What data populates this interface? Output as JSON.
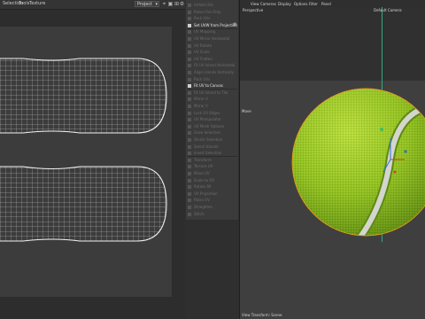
{
  "uv_editor": {
    "menu": [
      "Selection",
      "Tools",
      "Texture"
    ],
    "dropdown_value": "Project",
    "toolbar_icons": [
      "pin-icon",
      "lock-icon",
      "grid-icon",
      "settings-icon"
    ]
  },
  "command_panel": {
    "items": [
      {
        "label": "Unfold UVs",
        "active": false
      },
      {
        "label": "Relax UVs Only",
        "active": false
      },
      {
        "label": "Pack UVs",
        "active": false
      },
      {
        "label": "Set UVW from Projection",
        "active": true
      },
      {
        "label": "UV Mapping",
        "active": false
      },
      {
        "label": "UV Mirror Horizontal",
        "active": false
      },
      {
        "label": "UV Rotate",
        "active": false
      },
      {
        "label": "UV Scale",
        "active": false
      },
      {
        "label": "UV Flatten",
        "active": false
      },
      {
        "label": "Fit UV Island Horizontal",
        "active": false
      },
      {
        "label": "Align Islands Vertically",
        "active": false
      },
      {
        "label": "Pack UVs",
        "active": false
      },
      {
        "label": "Fit UV to Canvas",
        "active": true
      },
      {
        "label": "Fit UV Island to Tile",
        "active": false
      },
      {
        "label": "Mirror U",
        "active": false
      },
      {
        "label": "Mirror V",
        "active": false
      },
      {
        "label": "Lock UV Edges",
        "active": false
      },
      {
        "label": "UV Manipulator",
        "active": false
      },
      {
        "label": "UV Mesh Options",
        "active": false
      },
      {
        "label": "Grow Selection",
        "active": false
      },
      {
        "label": "Shrink Selection",
        "active": false
      },
      {
        "label": "Select Islands",
        "active": false
      },
      {
        "label": "Invert Selection",
        "active": false
      },
      {
        "label": "Transform",
        "active": false
      },
      {
        "label": "Terrace UV",
        "active": false
      },
      {
        "label": "Move UV",
        "active": false
      },
      {
        "label": "Scale to Fill",
        "active": false
      },
      {
        "label": "Rotate 90",
        "active": false
      },
      {
        "label": "UV Projection",
        "active": false
      },
      {
        "label": "Relax UV",
        "active": false
      },
      {
        "label": "Straighten",
        "active": false
      },
      {
        "label": "Stitch",
        "active": false
      }
    ]
  },
  "viewport": {
    "menu": [
      "View",
      "Cameras",
      "Display",
      "Options",
      "Filter",
      "Panel"
    ],
    "view_name": "Perspective",
    "camera_name": "Default Camera",
    "axis_label": "Move",
    "status_text": "View Transform: Scene",
    "ball_color": "#9bc92a",
    "seam_color": "#d7d7d2",
    "camera_line_color": "#34a883"
  }
}
